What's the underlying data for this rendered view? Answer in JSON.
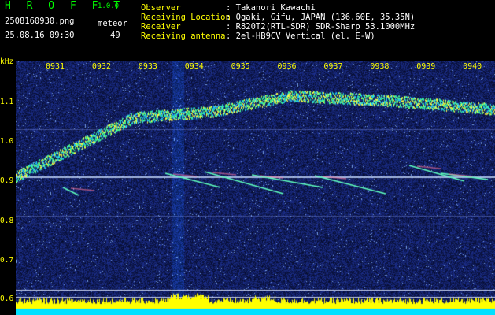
{
  "header": {
    "app_name": "H R O F F T",
    "version": "1.0.0",
    "file_name": "2508160930.png",
    "datetime": "25.08.16 09:30",
    "meteor_label": "meteor",
    "meteor_count": "49",
    "observer_label": "Observer",
    "observer_value": ": Takanori Kawachi",
    "location_label": "Receiving Location",
    "location_value": ": Ogaki, Gifu, JAPAN (136.60E, 35.35N)",
    "receiver_label": "Receiver",
    "receiver_value": ": R820T2(RTL-SDR) SDR-Sharp 53.1000MHz",
    "antenna_label": "Receiving antenna",
    "antenna_value": ": 2el-HB9CV Vertical (el. E-W)"
  },
  "axis": {
    "unit": "kHz",
    "time_ticks": [
      "0931",
      "0932",
      "0933",
      "0934",
      "0935",
      "0936",
      "0937",
      "0938",
      "0939",
      "0940"
    ],
    "freq_ticks": [
      "1.1",
      "1.0",
      "0.9",
      "0.8",
      "0.7",
      "0.6"
    ]
  },
  "colors": {
    "background": "#000000",
    "label_yellow": "#ffff00",
    "brand_green": "#00ff00",
    "text_white": "#ffffff",
    "noise_blue": "#1f2fa8",
    "signal_green": "#40ff90",
    "level_yellow": "#ffff00",
    "level_cyan": "#00e0ff"
  }
}
